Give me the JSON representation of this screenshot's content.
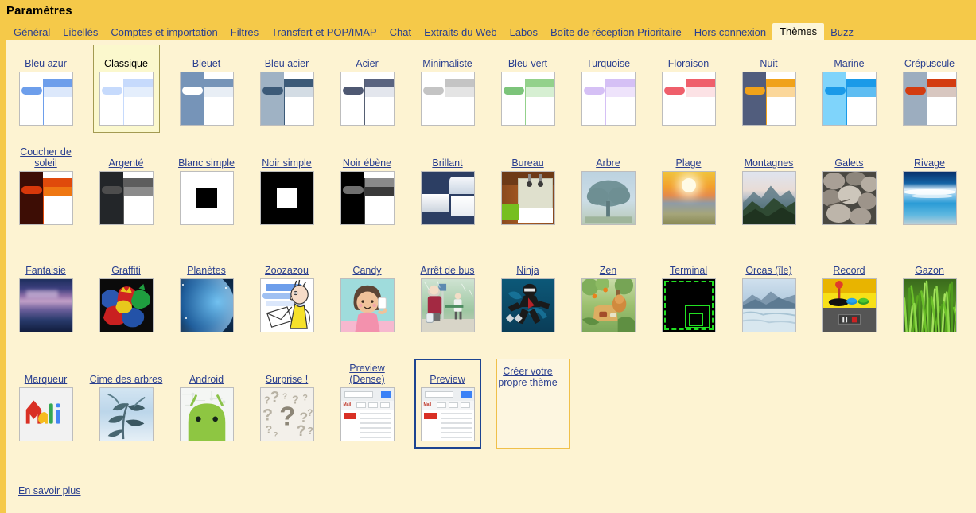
{
  "header": {
    "title": "Paramètres"
  },
  "tabs": [
    {
      "label": "Général",
      "active": false
    },
    {
      "label": "Libellés",
      "active": false
    },
    {
      "label": "Comptes et importation",
      "active": false
    },
    {
      "label": "Filtres",
      "active": false
    },
    {
      "label": "Transfert et POP/IMAP",
      "active": false
    },
    {
      "label": "Chat",
      "active": false
    },
    {
      "label": "Extraits du Web",
      "active": false
    },
    {
      "label": "Labos",
      "active": false
    },
    {
      "label": "Boîte de réception Prioritaire",
      "active": false
    },
    {
      "label": "Hors connexion",
      "active": false
    },
    {
      "label": "Thèmes",
      "active": true
    },
    {
      "label": "Buzz",
      "active": false
    }
  ],
  "themes": [
    {
      "label": "Bleu azur",
      "state": "normal",
      "style": "chrome",
      "accent": "#6d9eeb",
      "band": "#dce8fb",
      "bar": "#6d9eeb",
      "side": "#ffffff",
      "line": "#6d9eeb"
    },
    {
      "label": "Classique",
      "state": "selected",
      "style": "chrome",
      "accent": "#c6dafc",
      "band": "#e4eefc",
      "bar": "#c6dafc",
      "side": "#ffffff",
      "line": "#c6dafc"
    },
    {
      "label": "Bleuet",
      "state": "normal",
      "style": "chrome",
      "accent": "#7694b8",
      "band": "#e8eef5",
      "bar": "#ffffff",
      "side": "#7694b8",
      "line": "#7694b8"
    },
    {
      "label": "Bleu acier",
      "state": "normal",
      "style": "chrome",
      "accent": "#3c5a78",
      "band": "#d3dce4",
      "bar": "#3c5a78",
      "side": "#9fb2c4",
      "line": "#3c5a78"
    },
    {
      "label": "Acier",
      "state": "normal",
      "style": "chrome",
      "accent": "#5a6480",
      "band": "#e3e6ed",
      "bar": "#4e5872",
      "side": "#ffffff",
      "line": "#555f73"
    },
    {
      "label": "Minimaliste",
      "state": "normal",
      "style": "chrome",
      "accent": "#c4c4c4",
      "band": "#e4e4e4",
      "bar": "#c4c4c4",
      "side": "#ffffff",
      "line": "#c8c8c8"
    },
    {
      "label": "Bleu vert",
      "state": "normal",
      "style": "chrome",
      "accent": "#93d18b",
      "band": "#d6efd2",
      "bar": "#7cc47a",
      "side": "#ffffff",
      "line": "#93d18b"
    },
    {
      "label": "Turquoise",
      "state": "normal",
      "style": "chrome",
      "accent": "#d5c0f5",
      "band": "#eee3fb",
      "bar": "#d5c0f5",
      "side": "#ffffff",
      "line": "#d5c0f5"
    },
    {
      "label": "Floraison",
      "state": "normal",
      "style": "chrome",
      "accent": "#ef5f6b",
      "band": "#fce2e5",
      "bar": "#ef5f6b",
      "side": "#ffffff",
      "line": "#ef5f6b"
    },
    {
      "label": "Nuit",
      "state": "normal",
      "style": "chrome",
      "accent": "#f0a21a",
      "band": "#fbd79a",
      "bar": "#f0a21a",
      "side": "#515d7d",
      "line": "#f0a21a"
    },
    {
      "label": "Marine",
      "state": "normal",
      "style": "chrome",
      "accent": "#1a9ae8",
      "band": "#5ebdf2",
      "bar": "#1a9ae8",
      "side": "#7fd4fb",
      "line": "#1a9ae8"
    },
    {
      "label": "Crépuscule",
      "state": "normal",
      "style": "chrome",
      "accent": "#d33c10",
      "band": "#d8c7c0",
      "bar": "#d33c10",
      "side": "#9cadbf",
      "line": "#d33c10"
    },
    {
      "label": "Coucher de soleil",
      "state": "normal",
      "style": "chrome",
      "accent": "#e04a0b",
      "band": "#ef7712",
      "bar": "#d8380a",
      "side": "#3d0d05",
      "line": "#e04a0b",
      "top": "#3d0d05"
    },
    {
      "label": "Argenté",
      "state": "normal",
      "style": "chrome",
      "accent": "#5d5d5d",
      "band": "#8b8b8b",
      "bar": "#4d4d4d",
      "side": "#232629",
      "line": "#5d5d5d",
      "top": "#232629"
    },
    {
      "label": "Blanc simple",
      "state": "normal",
      "style": "square",
      "bg": "#ffffff",
      "sq": "#000000"
    },
    {
      "label": "Noir simple",
      "state": "normal",
      "style": "square",
      "bg": "#000000",
      "sq": "#ffffff"
    },
    {
      "label": "Noir ébène",
      "state": "normal",
      "style": "chrome",
      "accent": "#8a8a8a",
      "band": "#3a3a3a",
      "bar": "#6f6f6f",
      "side": "#000000",
      "line": "#3f3f3f",
      "top": "#000000"
    },
    {
      "label": "Brillant",
      "state": "normal",
      "style": "brillant",
      "navy": "#2c3e63"
    },
    {
      "label": "Bureau",
      "state": "normal",
      "style": "bureau"
    },
    {
      "label": "Arbre",
      "state": "normal",
      "style": "arbre"
    },
    {
      "label": "Plage",
      "state": "normal",
      "style": "plage"
    },
    {
      "label": "Montagnes",
      "state": "normal",
      "style": "montagnes"
    },
    {
      "label": "Galets",
      "state": "normal",
      "style": "galets"
    },
    {
      "label": "Rivage",
      "state": "normal",
      "style": "rivage"
    },
    {
      "label": "Fantaisie",
      "state": "normal",
      "style": "fantaisie"
    },
    {
      "label": "Graffiti",
      "state": "normal",
      "style": "graffiti"
    },
    {
      "label": "Planètes",
      "state": "normal",
      "style": "planetes"
    },
    {
      "label": "Zoozazou",
      "state": "normal",
      "style": "zoozazou"
    },
    {
      "label": "Candy",
      "state": "normal",
      "style": "candy"
    },
    {
      "label": "Arrêt de bus",
      "state": "normal",
      "style": "arretbus"
    },
    {
      "label": "Ninja",
      "state": "normal",
      "style": "ninja"
    },
    {
      "label": "Zen",
      "state": "normal",
      "style": "zen"
    },
    {
      "label": "Terminal",
      "state": "normal",
      "style": "terminal"
    },
    {
      "label": "Orcas (île)",
      "state": "normal",
      "style": "orcas"
    },
    {
      "label": "Record",
      "state": "normal",
      "style": "record"
    },
    {
      "label": "Gazon",
      "state": "normal",
      "style": "gazon"
    },
    {
      "label": "Marqueur",
      "state": "normal",
      "style": "marqueur"
    },
    {
      "label": "Cime des arbres",
      "state": "normal",
      "style": "cime"
    },
    {
      "label": "Android",
      "state": "normal",
      "style": "android"
    },
    {
      "label": "Surprise !",
      "state": "normal",
      "style": "surprise"
    },
    {
      "label": "Preview (Dense)",
      "state": "normal",
      "style": "preview"
    },
    {
      "label": "Preview",
      "state": "hovered",
      "style": "preview"
    },
    {
      "label": "Créer votre propre thème",
      "state": "create",
      "style": "create"
    }
  ],
  "footer": {
    "learn_more": "En savoir plus"
  },
  "colors": {
    "page_background": "#f5c949",
    "panel_background": "#fdf3d2",
    "link": "#2a3f8f",
    "active_tab_background": "#fdf6d8",
    "selected_border": "#a39a52",
    "selected_fill": "#fbf8cd",
    "hover_border": "#1d4491",
    "create_border": "#f0c04a"
  }
}
